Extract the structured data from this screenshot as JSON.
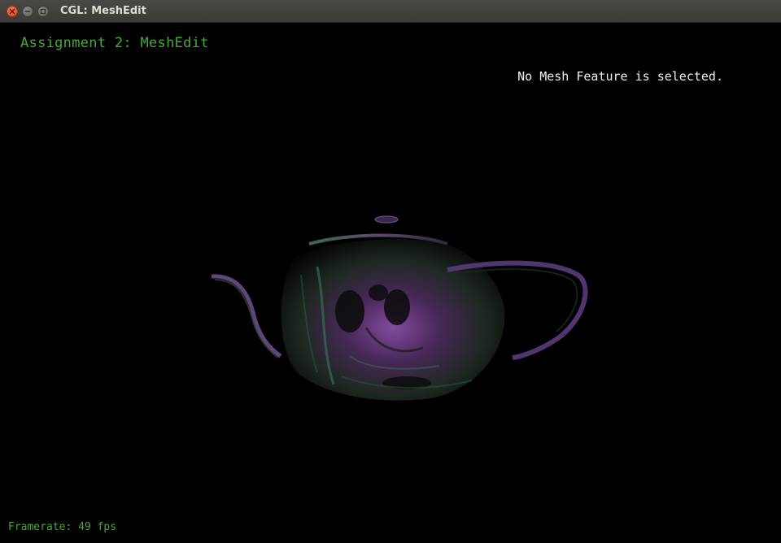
{
  "window": {
    "title": "CGL: MeshEdit",
    "controls": [
      "close-icon",
      "minimize-icon",
      "maximize-icon"
    ]
  },
  "viewport": {
    "assignment_title": "Assignment 2: MeshEdit",
    "status_text": "No Mesh Feature is selected.",
    "framerate_text": "Framerate: 49 fps",
    "mesh_object": "teapot"
  },
  "colors": {
    "background": "#000000",
    "hud_green": "#3fae2f",
    "status_white": "#f0f0f0",
    "titlebar": "#3b3a36",
    "close_button": "#e2552a"
  }
}
